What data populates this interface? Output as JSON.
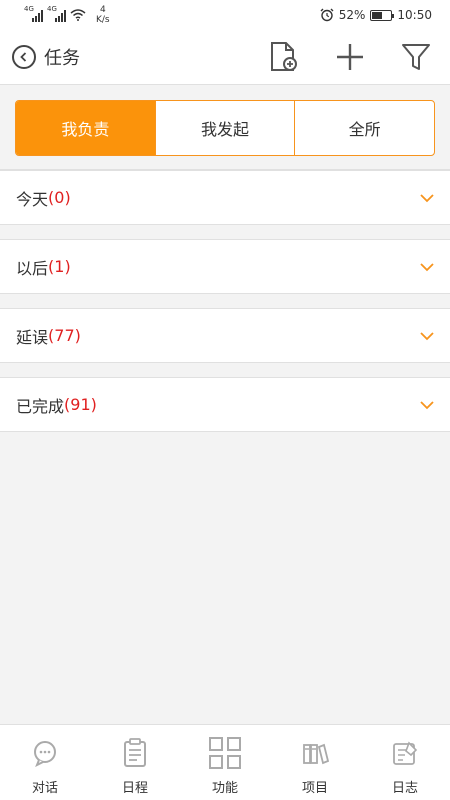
{
  "status_bar": {
    "network_1": "4G",
    "network_2": "4G",
    "speed_value": "4",
    "speed_unit": "K/s",
    "battery_percent": "52%",
    "battery_level": 0.52,
    "time": "10:50"
  },
  "nav": {
    "title": "任务",
    "back_icon": "back-circle-icon",
    "actions": [
      "new-document-icon",
      "plus-icon",
      "filter-icon"
    ]
  },
  "segment": {
    "items": [
      {
        "label": "我负责",
        "active": true
      },
      {
        "label": "我发起",
        "active": false
      },
      {
        "label": "全所",
        "active": false
      }
    ],
    "accent_color": "#fb930b"
  },
  "groups": [
    {
      "label": "今天",
      "count": "(0)"
    },
    {
      "label": "以后",
      "count": "(1)"
    },
    {
      "label": "延误",
      "count": "(77)"
    },
    {
      "label": "已完成",
      "count": "(91)"
    }
  ],
  "tabbar": {
    "items": [
      {
        "label": "对话",
        "icon": "chat-bubble-icon"
      },
      {
        "label": "日程",
        "icon": "clipboard-icon"
      },
      {
        "label": "功能",
        "icon": "grid-icon"
      },
      {
        "label": "项目",
        "icon": "folders-icon"
      },
      {
        "label": "日志",
        "icon": "notepad-icon"
      }
    ]
  }
}
